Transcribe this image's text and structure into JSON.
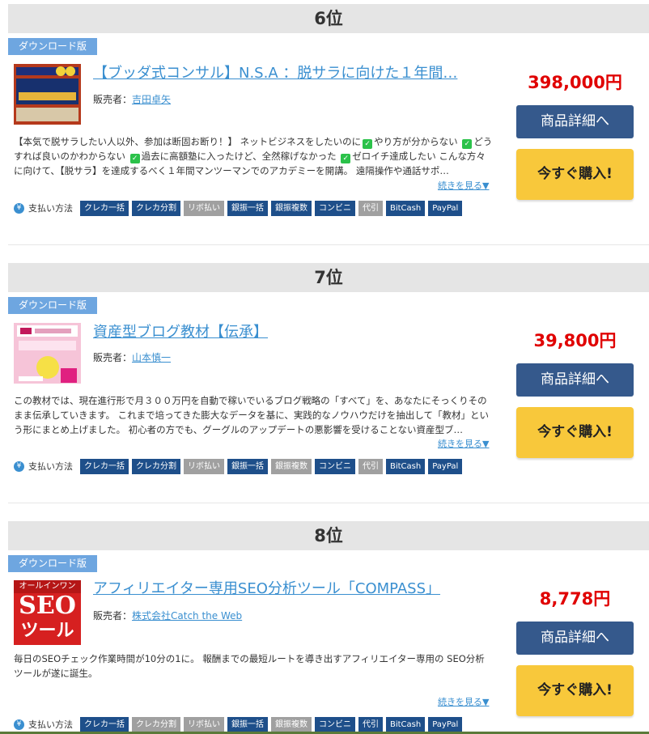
{
  "items": [
    {
      "rank": "6位",
      "badge": "ダウンロード版",
      "title": "【ブッダ式コンサル】N.S.A ：脱サラに向けた１年間…",
      "seller_label": "販売者：",
      "seller": "吉田卓矢",
      "description_parts": [
        "【本気で脱サラしたい人以外、参加は断固お断り！】 ネットビジネスをしたいのに",
        "やり方が分からない",
        "どうすれば良いのかわからない",
        "過去に高額塾に入ったけど、全然稼げなかった",
        "ゼロイチ達成したい こんな方々に向けて、【脱サラ】を達成するべく１年間マンツーマンでのアカデミーを開講。 遠隔操作や通話サポ…"
      ],
      "more": "続きを見る▼",
      "pay_label": "支払い方法",
      "payments": [
        {
          "label": "クレカ一括",
          "on": true
        },
        {
          "label": "クレカ分割",
          "on": true
        },
        {
          "label": "リボ払い",
          "on": false
        },
        {
          "label": "銀振一括",
          "on": true
        },
        {
          "label": "銀振複数",
          "on": true
        },
        {
          "label": "コンビニ",
          "on": true
        },
        {
          "label": "代引",
          "on": false
        },
        {
          "label": "BitCash",
          "on": true
        },
        {
          "label": "PayPal",
          "on": true
        }
      ],
      "price": "398,000円",
      "detail_button": "商品詳細へ",
      "buy_button": "今すぐ購入!"
    },
    {
      "rank": "7位",
      "badge": "ダウンロード版",
      "title": "資産型ブログ教材【伝承】",
      "seller_label": "販売者：",
      "seller": "山本慎一",
      "description": "この教材では、現在進行形で月３００万円を自動で稼いでいるブログ戦略の「すべて」を、あなたにそっくりそのまま伝承していきます。 これまで培ってきた膨大なデータを基に、実践的なノウハウだけを抽出して「教材」という形にまとめ上げました。 初心者の方でも、グーグルのアップデートの悪影響を受けることない資産型ブ…",
      "more": "続きを見る▼",
      "pay_label": "支払い方法",
      "payments": [
        {
          "label": "クレカ一括",
          "on": true
        },
        {
          "label": "クレカ分割",
          "on": true
        },
        {
          "label": "リボ払い",
          "on": false
        },
        {
          "label": "銀振一括",
          "on": true
        },
        {
          "label": "銀振複数",
          "on": false
        },
        {
          "label": "コンビニ",
          "on": true
        },
        {
          "label": "代引",
          "on": false
        },
        {
          "label": "BitCash",
          "on": true
        },
        {
          "label": "PayPal",
          "on": true
        }
      ],
      "price": "39,800円",
      "detail_button": "商品詳細へ",
      "buy_button": "今すぐ購入!"
    },
    {
      "rank": "8位",
      "badge": "ダウンロード版",
      "title": "アフィリエイター専用SEO分析ツール「COMPASS」",
      "seller_label": "販売者：",
      "seller": "株式会社Catch the Web",
      "description": "毎日のSEOチェック作業時間が10分の1に。 報酬までの最短ルートを導き出すアフィリエイター専用の SEO分析ツールが遂に誕生。",
      "more": "続きを見る▼",
      "pay_label": "支払い方法",
      "payments": [
        {
          "label": "クレカ一括",
          "on": true
        },
        {
          "label": "クレカ分割",
          "on": false
        },
        {
          "label": "リボ払い",
          "on": false
        },
        {
          "label": "銀振一括",
          "on": true
        },
        {
          "label": "銀振複数",
          "on": false
        },
        {
          "label": "コンビニ",
          "on": true
        },
        {
          "label": "代引",
          "on": true
        },
        {
          "label": "BitCash",
          "on": true
        },
        {
          "label": "PayPal",
          "on": true
        }
      ],
      "price": "8,778円",
      "detail_button": "商品詳細へ",
      "buy_button": "今すぐ購入!",
      "thumb_text": [
        "オールインワン",
        "SEO",
        "ツール"
      ]
    }
  ],
  "icons": {
    "check": "check-icon",
    "yen": "yen-icon"
  },
  "colors": {
    "price": "#e00000",
    "detail_button": "#35598c",
    "buy_button": "#f8c83b",
    "chip_on": "#1e4f8a",
    "chip_off": "#a0a0a0"
  }
}
